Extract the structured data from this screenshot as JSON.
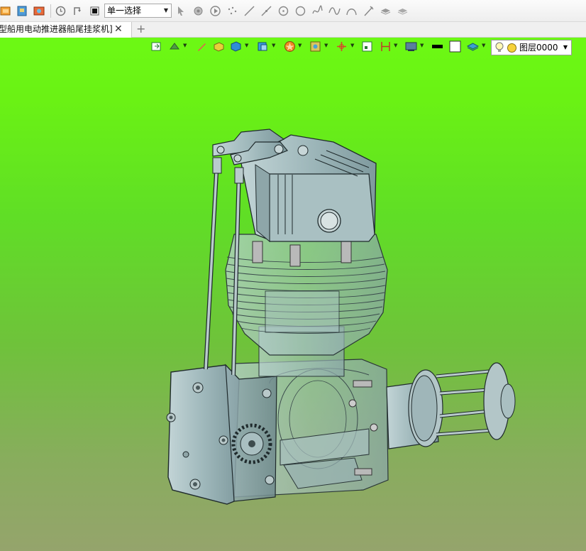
{
  "toolbar": {
    "select_mode_value": "单一选择"
  },
  "tabs": [
    {
      "label": "型船用电动推进器船尾挂浆机]",
      "close_glyph": "✕"
    }
  ],
  "tab_add_glyph": "+",
  "view_toolbar": {
    "layer_select_value": "图层0000"
  },
  "colors": {
    "viewport_top": "#6cf914",
    "viewport_bottom": "#95a46c",
    "model_fill": "#9fb8bb",
    "model_stroke": "#2a3638"
  },
  "icons": {
    "top_toolbar": [
      "new-part-icon",
      "open-file-icon",
      "import-icon",
      "history-icon",
      "rollback-icon",
      "stop-icon",
      "pointer-icon",
      "fillet-icon",
      "play-icon",
      "point-icon",
      "line-icon",
      "tangent-line-icon",
      "circle-icon",
      "ring-icon",
      "spline-icon",
      "wave-icon",
      "arc-icon",
      "pin-icon",
      "layer-stack-icon",
      "layer-stack-2-icon"
    ],
    "view_toolbar": [
      "import-view-icon",
      "render-mode-icon",
      "pen-icon",
      "shaded-box-icon",
      "cube-icon",
      "view-cube-icon",
      "star-icon",
      "scene-icon",
      "axis-icon",
      "measure-box-icon",
      "frame-icon",
      "display-icon",
      "color-black-icon",
      "color-white-icon",
      "layer-icon",
      "bulb-icon",
      "sun-icon"
    ]
  }
}
